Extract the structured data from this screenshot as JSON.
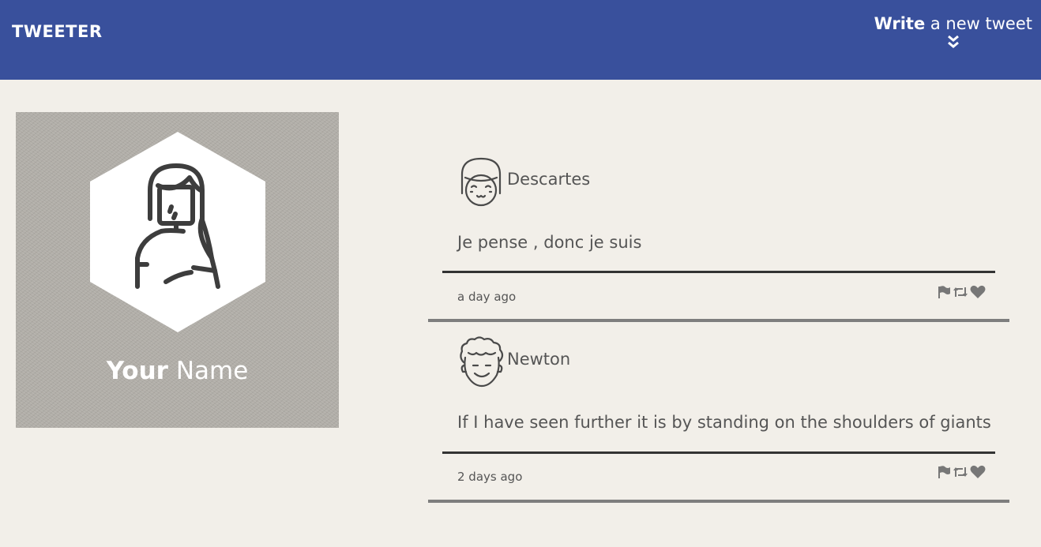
{
  "navbar": {
    "brand": "TWEETER",
    "compose_strong": "Write",
    "compose_rest": " a new tweet",
    "compose_icon": "double-chevron-down-icon",
    "background": "#39509c"
  },
  "profile": {
    "name_strong": "Your",
    "name_rest": " Name"
  },
  "tweets": [
    {
      "name": "Descartes",
      "text": "Je pense , donc je suis",
      "time": "a day ago",
      "avatar_icon": "girl-face-avatar-icon"
    },
    {
      "name": "Newton",
      "text": "If I have seen further it is by standing on the shoulders of giants",
      "time": "2 days ago",
      "avatar_icon": "curly-hair-avatar-icon"
    }
  ],
  "actions": [
    "flag-icon",
    "retweet-icon",
    "heart-icon"
  ],
  "colors": {
    "page_background": "#f2efe9",
    "text": "#555555",
    "action_icons": "#777777"
  }
}
